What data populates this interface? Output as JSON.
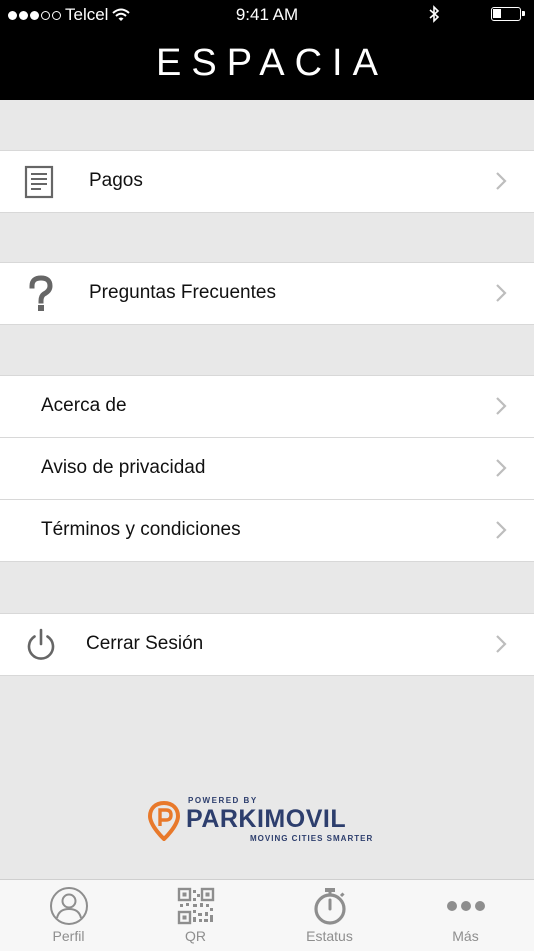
{
  "status_bar": {
    "carrier": "Telcel",
    "time": "9:41 AM"
  },
  "header": {
    "title": "ESPACIA"
  },
  "menu": {
    "pagos": "Pagos",
    "faq": "Preguntas Frecuentes",
    "acerca": "Acerca de",
    "aviso": "Aviso de privacidad",
    "terminos": "Términos y condiciones",
    "cerrar": "Cerrar Sesión"
  },
  "footer": {
    "powered_by": "POWERED BY",
    "brand": "PARKIMOVIL",
    "tagline": "MOVING CITIES SMARTER"
  },
  "tabbar": {
    "perfil": "Perfil",
    "qr": "QR",
    "estatus": "Estatus",
    "mas": "Más"
  },
  "colors": {
    "header_bg": "#000000",
    "background": "#e8e8e8",
    "brand_navy": "#2d3e6d",
    "brand_orange": "#e8792b",
    "tab_inactive": "#8e8e8e"
  }
}
